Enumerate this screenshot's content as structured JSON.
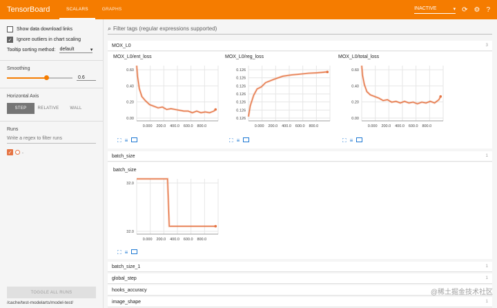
{
  "topbar": {
    "title": "TensorBoard",
    "tabs": [
      {
        "label": "SCALARS"
      },
      {
        "label": "GRAPHS"
      }
    ],
    "status_select": "INACTIVE",
    "colors": {
      "bar": "#f57c00",
      "series": "#e57342"
    },
    "icons": [
      "dropdown-arrow-icon",
      "refresh-icon",
      "gear-icon",
      "help-icon"
    ]
  },
  "sidebar": {
    "show_download_label": "Show data download links",
    "ignore_outliers_label": "Ignore outliers in chart scaling",
    "tooltip_sort_label": "Tooltip sorting method:",
    "tooltip_sort_value": "default",
    "smoothing_label": "Smoothing",
    "smoothing_value": "0.6",
    "smoothing_fraction": 0.6,
    "horizontal_axis_label": "Horizontal Axis",
    "axis_options": [
      {
        "label": "STEP"
      },
      {
        "label": "RELATIVE"
      },
      {
        "label": "WALL"
      }
    ],
    "runs_label": "Runs",
    "runs_filter_placeholder": "Write a regex to filter runs",
    "run_label": ".",
    "toggle_all_label": "TOGGLE ALL RUNS",
    "log_path": "/cache/test-modelarts/model-test/"
  },
  "main": {
    "filter_placeholder": "Filter tags (regular expressions supported)",
    "categories": [
      {
        "name": "MOX_L0",
        "count": "3"
      },
      {
        "name": "batch_size",
        "count": "1"
      },
      {
        "name": "batch_size_1",
        "count": "1"
      },
      {
        "name": "global_step",
        "count": "1"
      },
      {
        "name": "hooks_accuracy",
        "count": "1"
      },
      {
        "name": "image_shape",
        "count": "1"
      }
    ]
  },
  "watermark": "@稀土掘金技术社区",
  "chart_data": [
    {
      "type": "line",
      "title": "MOX_L0/ent_loss",
      "xlim": [
        0,
        950
      ],
      "ylim": [
        0,
        0.68
      ],
      "x_ticks": [
        "0.000",
        "200.0",
        "400.0",
        "600.0",
        "800.0"
      ],
      "y_ticks": [
        "0.00",
        "0.20",
        "0.40",
        "0.60"
      ],
      "series": [
        {
          "x": [
            0,
            10,
            30,
            60,
            100,
            150,
            200,
            250,
            300,
            350,
            400,
            450,
            500,
            550,
            600,
            650,
            700,
            750,
            800,
            850,
            900,
            920
          ],
          "values": [
            0.68,
            0.55,
            0.4,
            0.3,
            0.25,
            0.2,
            0.18,
            0.16,
            0.17,
            0.14,
            0.15,
            0.14,
            0.13,
            0.12,
            0.12,
            0.1,
            0.12,
            0.1,
            0.11,
            0.1,
            0.12,
            0.14
          ]
        }
      ]
    },
    {
      "type": "line",
      "title": "MOX_L0/reg_loss",
      "xlim": [
        0,
        950
      ],
      "ylim": [
        0.1255,
        0.1268
      ],
      "x_ticks": [
        "0.000",
        "200.0",
        "400.0",
        "600.0",
        "800.0"
      ],
      "y_ticks": [
        "0.126",
        "0.126",
        "0.126",
        "0.126",
        "0.126",
        "0.126",
        "0.126"
      ],
      "series": [
        {
          "x": [
            0,
            20,
            60,
            100,
            150,
            200,
            300,
            400,
            500,
            600,
            700,
            800,
            900,
            920
          ],
          "values": [
            0.1256,
            0.12585,
            0.1261,
            0.12625,
            0.1263,
            0.1264,
            0.12648,
            0.12655,
            0.12658,
            0.1266,
            0.12662,
            0.12663,
            0.12665,
            0.12665
          ]
        }
      ]
    },
    {
      "type": "line",
      "title": "MOX_L0/total_loss",
      "xlim": [
        0,
        950
      ],
      "ylim": [
        0,
        0.68
      ],
      "x_ticks": [
        "0.000",
        "200.0",
        "400.0",
        "600.0",
        "800.0"
      ],
      "y_ticks": [
        "0.00",
        "0.20",
        "0.40",
        "0.60"
      ],
      "series": [
        {
          "x": [
            0,
            10,
            30,
            60,
            100,
            150,
            200,
            250,
            300,
            350,
            400,
            450,
            500,
            550,
            600,
            650,
            700,
            750,
            800,
            850,
            900,
            920
          ],
          "values": [
            0.68,
            0.56,
            0.45,
            0.36,
            0.32,
            0.3,
            0.28,
            0.25,
            0.26,
            0.23,
            0.24,
            0.22,
            0.24,
            0.22,
            0.23,
            0.21,
            0.23,
            0.22,
            0.24,
            0.22,
            0.26,
            0.3
          ]
        }
      ]
    },
    {
      "type": "line",
      "title": "batch_size",
      "xlim": [
        0,
        950
      ],
      "ylim": [
        31.7,
        32.4
      ],
      "x_ticks": [
        "0.000",
        "200.0",
        "400.0",
        "600.0",
        "800.0"
      ],
      "y_ticks": [
        "32.0",
        "32.0"
      ],
      "series": [
        {
          "x": [
            0,
            360,
            380,
            920
          ],
          "values": [
            32.4,
            32.4,
            31.8,
            31.8
          ]
        }
      ]
    }
  ]
}
